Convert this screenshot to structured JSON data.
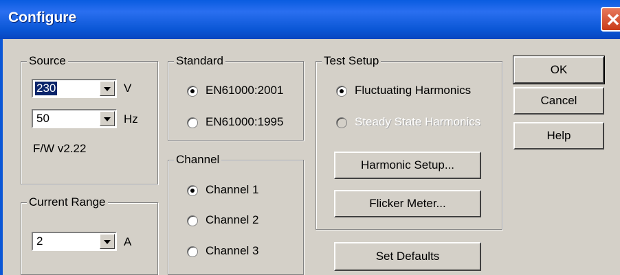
{
  "window": {
    "title": "Configure"
  },
  "source": {
    "label": "Source",
    "voltage_value": "230",
    "voltage_unit": "V",
    "frequency_value": "50",
    "frequency_unit": "Hz",
    "firmware": "F/W v2.22"
  },
  "current_range": {
    "label": "Current Range",
    "value": "2",
    "unit": "A"
  },
  "standard": {
    "label": "Standard",
    "options": [
      {
        "label": "EN61000:2001",
        "checked": true
      },
      {
        "label": "EN61000:1995",
        "checked": false
      }
    ]
  },
  "channel": {
    "label": "Channel",
    "options": [
      {
        "label": "Channel 1",
        "checked": true
      },
      {
        "label": "Channel 2",
        "checked": false
      },
      {
        "label": "Channel 3",
        "checked": false
      }
    ]
  },
  "test_setup": {
    "label": "Test Setup",
    "options": [
      {
        "label": "Fluctuating Harmonics",
        "checked": true,
        "enabled": true
      },
      {
        "label": "Steady State Harmonics",
        "checked": false,
        "enabled": false
      }
    ],
    "harmonic_setup_label": "Harmonic Setup...",
    "flicker_meter_label": "Flicker Meter..."
  },
  "buttons": {
    "ok": "OK",
    "cancel": "Cancel",
    "help": "Help",
    "set_defaults": "Set Defaults"
  }
}
